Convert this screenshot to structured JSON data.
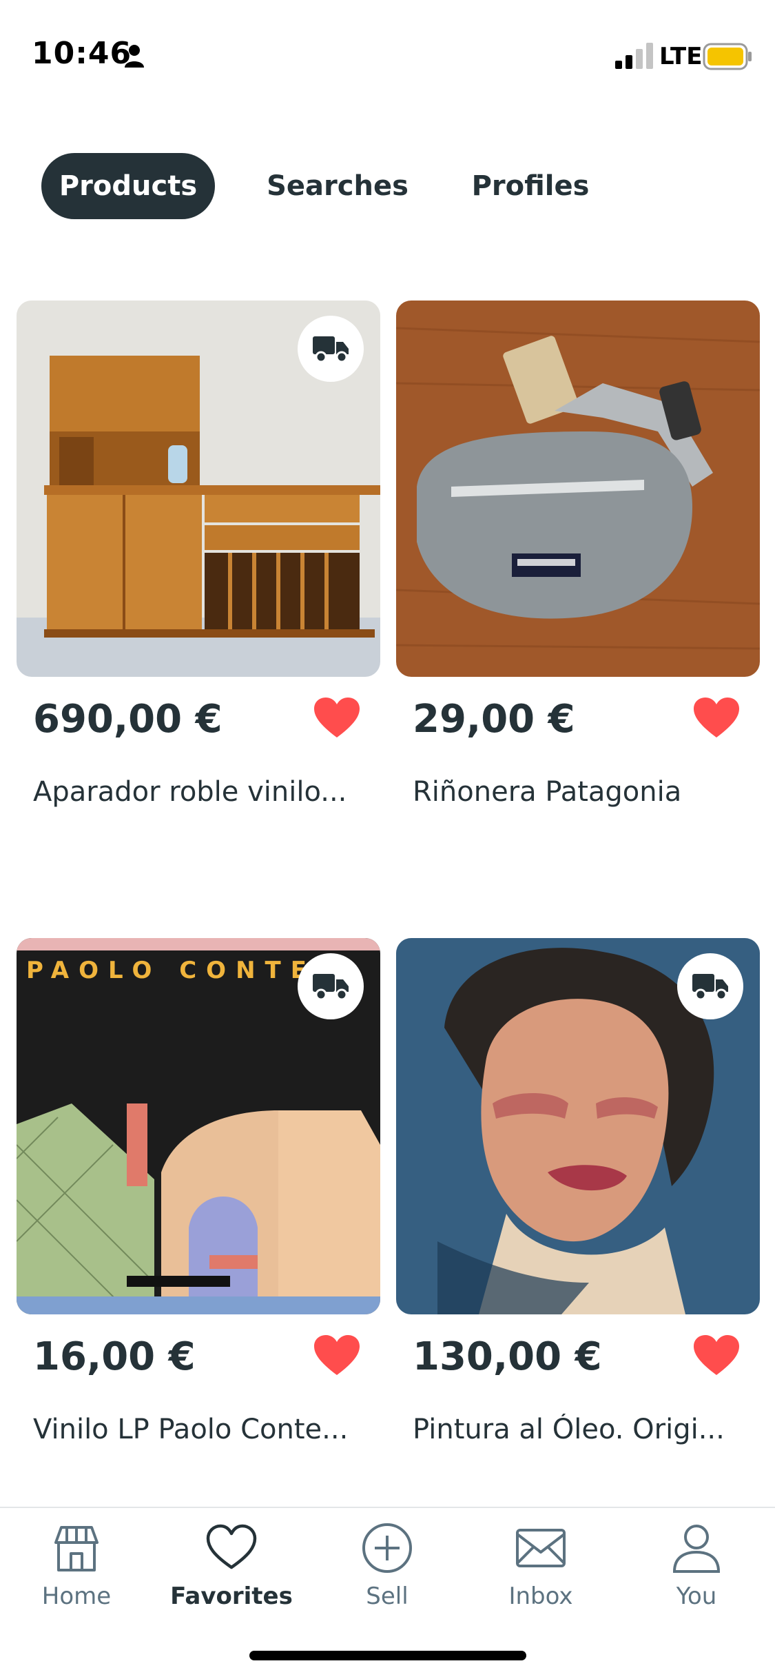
{
  "status_bar": {
    "time": "10:46",
    "network": "LTE",
    "icons": [
      "person-icon",
      "signal-icon",
      "battery-icon"
    ],
    "battery_color": "#f5c400"
  },
  "tabs": [
    {
      "label": "Products",
      "active": true
    },
    {
      "label": "Searches",
      "active": false
    },
    {
      "label": "Profiles",
      "active": false
    }
  ],
  "products": [
    {
      "price": "690,00 €",
      "title": "Aparador roble vinilo...",
      "shipping": true,
      "favorited": true,
      "image": "teak sideboard cabinet"
    },
    {
      "price": "29,00 €",
      "title": "Riñonera Patagonia",
      "shipping": false,
      "favorited": true,
      "image": "grey waist bag on wooden table"
    },
    {
      "price": "16,00 €",
      "title": "Vinilo LP Paolo Conte...",
      "shipping": true,
      "favorited": true,
      "image": "vinyl LP cover",
      "image_text": "PAOLO CONTE"
    },
    {
      "price": "130,00 €",
      "title": "Pintura al Óleo. Origi...",
      "shipping": true,
      "favorited": true,
      "image": "oil portrait painting"
    }
  ],
  "nav": [
    {
      "label": "Home",
      "icon": "shop-icon",
      "active": false
    },
    {
      "label": "Favorites",
      "icon": "heart-icon",
      "active": true
    },
    {
      "label": "Sell",
      "icon": "plus-circle-icon",
      "active": false
    },
    {
      "label": "Inbox",
      "icon": "envelope-icon",
      "active": false
    },
    {
      "label": "You",
      "icon": "user-icon",
      "active": false
    }
  ],
  "colors": {
    "primary_dark": "#253238",
    "heart": "#ff4d4d",
    "nav_inactive": "#5c7280"
  }
}
